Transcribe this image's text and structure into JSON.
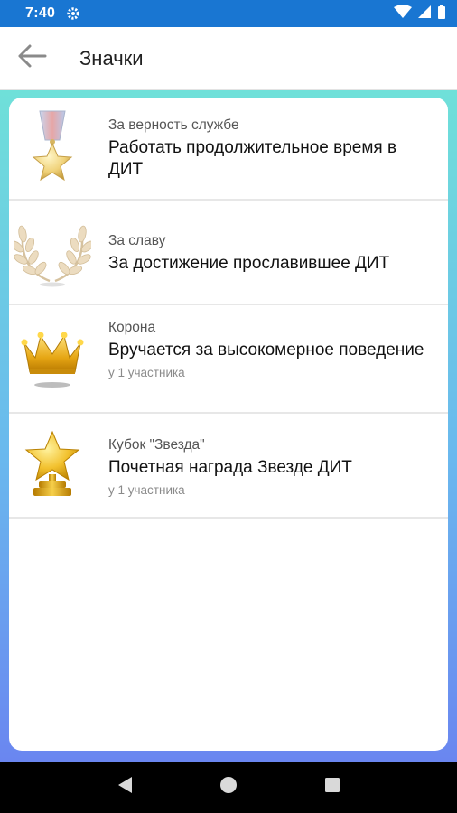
{
  "status_bar": {
    "time": "7:40",
    "icons": [
      "gear-icon",
      "wifi-icon",
      "signal-icon",
      "battery-icon"
    ]
  },
  "app_bar": {
    "title": "Значки",
    "back_icon": "arrow-left-icon"
  },
  "badges": [
    {
      "icon": "medal-star-icon",
      "name": "За верность службе",
      "description": "Работать продолжительное время в ДИТ",
      "count": ""
    },
    {
      "icon": "laurel-wreath-icon",
      "name": "За славу",
      "description": "За достижение прославившее ДИТ",
      "count": ""
    },
    {
      "icon": "crown-icon",
      "name": "Корона",
      "description": "Вручается за высокомерное поведение",
      "count": "у 1 участника"
    },
    {
      "icon": "star-trophy-icon",
      "name": "Кубок \"Звезда\"",
      "description": "Почетная награда Звезде ДИТ",
      "count": "у 1 участника"
    }
  ],
  "nav_bar": {
    "buttons": [
      "back-triangle-icon",
      "home-circle-icon",
      "recents-square-icon"
    ]
  },
  "colors": {
    "status_bar": "#1976d2",
    "gradient_top": "#6fe0d9",
    "gradient_bottom": "#6a86f0",
    "gold": "#f2c12e"
  }
}
